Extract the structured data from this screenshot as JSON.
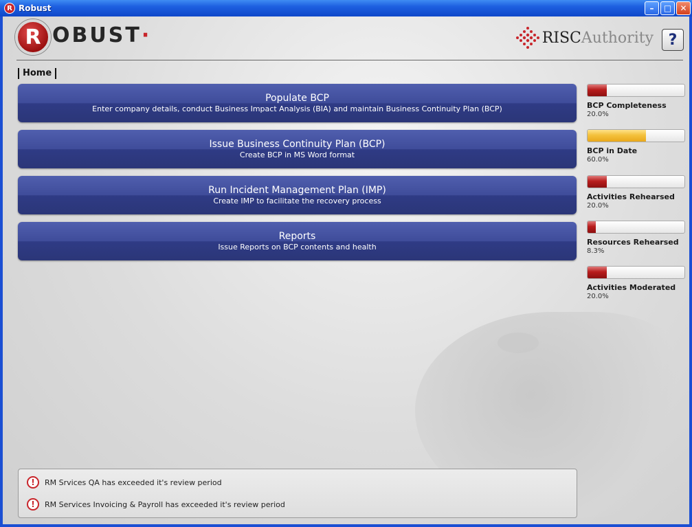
{
  "window": {
    "title": "Robust",
    "app_icon_letter": "R",
    "buttons": {
      "minimize": "–",
      "maximize": "□",
      "close": "✕"
    }
  },
  "header": {
    "logo_letter": "R",
    "logo_text": "OBUST",
    "logo_dot": "·",
    "partner_strong": "RISC",
    "partner_light": "Authority",
    "help_label": "?"
  },
  "breadcrumb": {
    "home": "Home"
  },
  "actions": [
    {
      "title": "Populate BCP",
      "description": "Enter company details, conduct Business Impact Analysis (BIA) and maintain Business Continuity Plan (BCP)"
    },
    {
      "title": "Issue Business Continuity Plan (BCP)",
      "description": "Create BCP in MS Word format"
    },
    {
      "title": "Run Incident Management Plan (IMP)",
      "description": "Create IMP to facilitate the recovery process"
    },
    {
      "title": "Reports",
      "description": "Issue Reports on BCP contents and health"
    }
  ],
  "stats": [
    {
      "label": "BCP Completeness",
      "value": "20.0%",
      "progress": 0.2,
      "color": "#b81d1d"
    },
    {
      "label": "BCP in Date",
      "value": "60.0%",
      "progress": 0.6,
      "color": "#f4c13d"
    },
    {
      "label": "Activities Rehearsed",
      "value": "20.0%",
      "progress": 0.2,
      "color": "#b81d1d"
    },
    {
      "label": "Resources Rehearsed",
      "value": "8.3%",
      "progress": 0.083,
      "color": "#b81d1d"
    },
    {
      "label": "Activities Moderated",
      "value": "20.0%",
      "progress": 0.2,
      "color": "#b81d1d"
    }
  ],
  "alerts": [
    {
      "icon": "warning-icon",
      "glyph": "!",
      "text": "RM Srvices QA has exceeded it's review period"
    },
    {
      "icon": "warning-icon",
      "glyph": "!",
      "text": "RM Services Invoicing & Payroll has exceeded it's review period"
    }
  ],
  "colors": {
    "titlebar": "#1d5fe0",
    "action_button": "#3f4c9a",
    "logo_red": "#c8252b"
  }
}
